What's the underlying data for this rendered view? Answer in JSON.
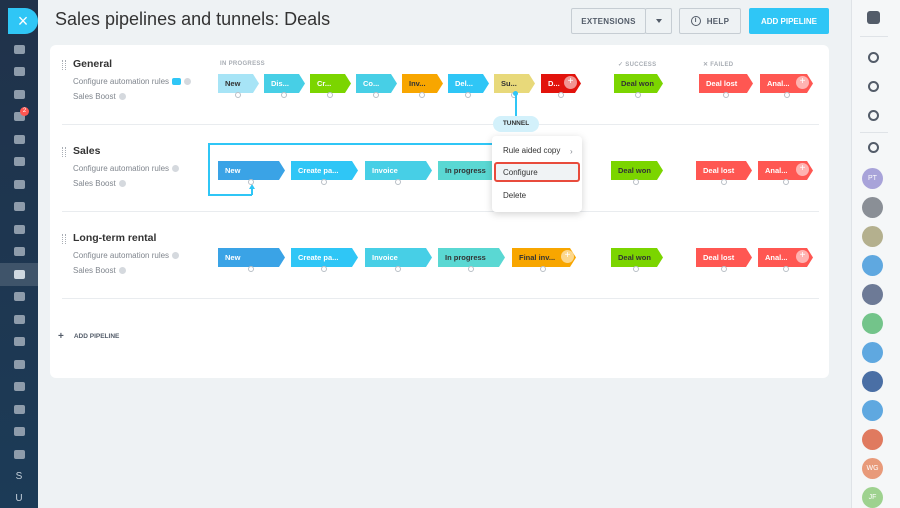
{
  "header": {
    "title": "Sales pipelines and tunnels: Deals",
    "extensions_label": "EXTENSIONS",
    "help_label": "HELP",
    "add_pipeline_label": "ADD PIPELINE"
  },
  "leftbar": {
    "close_icon": "×",
    "notification_count": "2",
    "letters": [
      "S",
      "U"
    ]
  },
  "columns": {
    "in_progress": "IN PROGRESS",
    "success": "✓ SUCCESS",
    "failed": "✕ FAILED"
  },
  "pipelines": [
    {
      "title": "General",
      "automation": "Configure automation rules",
      "boost": "Sales Boost",
      "stages": [
        "New",
        "Dis...",
        "Cr...",
        "Co...",
        "Inv...",
        "Del...",
        "Su...",
        "D..."
      ],
      "success": "Deal won",
      "failed": [
        "Deal lost",
        "Anal..."
      ]
    },
    {
      "title": "Sales",
      "automation": "Configure automation rules",
      "boost": "Sales Boost",
      "stages": [
        "New",
        "Create pa...",
        "Invoice",
        "In progress"
      ],
      "success": "Deal won",
      "failed": [
        "Deal lost",
        "Anal..."
      ]
    },
    {
      "title": "Long-term rental",
      "automation": "Configure automation rules",
      "boost": "Sales Boost",
      "stages": [
        "New",
        "Create pa...",
        "Invoice",
        "In progress",
        "Final inv..."
      ],
      "success": "Deal won",
      "failed": [
        "Deal lost",
        "Anal..."
      ]
    }
  ],
  "tunnel_label": "TUNNEL",
  "context_menu": {
    "items": [
      "Rule aided copy",
      "Configure",
      "Delete"
    ],
    "selected": "Configure"
  },
  "add_pipeline_bottom": "ADD PIPELINE",
  "rightbar": {
    "avatars": [
      "PT",
      "WG",
      "JF"
    ]
  },
  "colors": {
    "accent": "#2fc6f6",
    "stage_light_blue": "#a7e4f6",
    "stage_blue": "#3aa3e6",
    "stage_cyan": "#47cfe6",
    "stage_teal": "#5ad8d3",
    "stage_green": "#7bd500",
    "stage_orange": "#f8a600",
    "stage_yellow": "#e8d97a",
    "stage_red": "#e2130c",
    "deal_won": "#7bd500",
    "deal_lost": "#ff5752"
  }
}
